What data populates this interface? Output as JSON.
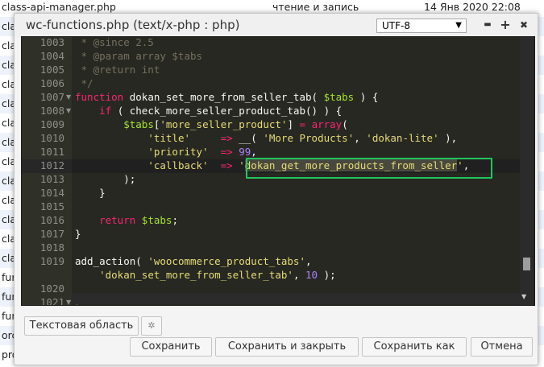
{
  "background_rows": [
    {
      "name": "class-api-manager.php",
      "perm": "чтение и запись",
      "date": "14 Янв 2020 22:08"
    },
    {
      "name": "cla"
    },
    {
      "name": "cla"
    },
    {
      "name": "cla"
    },
    {
      "name": "cla"
    },
    {
      "name": "cla"
    },
    {
      "name": "cla"
    },
    {
      "name": "cla"
    },
    {
      "name": "cla"
    },
    {
      "name": "cla"
    },
    {
      "name": "cla"
    },
    {
      "name": "cla"
    },
    {
      "name": "cla"
    },
    {
      "name": "cla"
    },
    {
      "name": "fur"
    },
    {
      "name": "fur"
    },
    {
      "name": "fur"
    },
    {
      "name": "orc"
    },
    {
      "name": "pro"
    }
  ],
  "dialog": {
    "title": "wc-functions.php (text/x-php : php)",
    "encoding": "UTF-8",
    "minimize": "▬",
    "maximize": "+",
    "close": "✖"
  },
  "editor": {
    "lines": [
      {
        "num": "1003",
        "fold": "",
        "segments": [
          {
            "t": " * @since 2.5",
            "c": "c-comment"
          }
        ]
      },
      {
        "num": "1004",
        "fold": "",
        "segments": [
          {
            "t": " * @param array $tabs",
            "c": "c-comment"
          }
        ]
      },
      {
        "num": "1005",
        "fold": "",
        "segments": [
          {
            "t": " * @return int",
            "c": "c-comment"
          }
        ]
      },
      {
        "num": "1006",
        "fold": "",
        "segments": [
          {
            "t": " */",
            "c": "c-comment"
          }
        ]
      },
      {
        "num": "1007",
        "fold": "▼",
        "segments": [
          {
            "t": "function",
            "c": "c-kw"
          },
          {
            "t": " dokan_set_more_from_seller_tab( ",
            "c": "c-plain"
          },
          {
            "t": "$tabs",
            "c": "c-var"
          },
          {
            "t": " ) {",
            "c": "c-plain"
          }
        ]
      },
      {
        "num": "1008",
        "fold": "▼",
        "segments": [
          {
            "t": "    ",
            "c": "c-plain"
          },
          {
            "t": "if",
            "c": "c-kw"
          },
          {
            "t": " ( check_more_seller_product_tab() ) {",
            "c": "c-plain"
          }
        ]
      },
      {
        "num": "1009",
        "fold": "",
        "segments": [
          {
            "t": "        ",
            "c": "c-plain"
          },
          {
            "t": "$tabs",
            "c": "c-var"
          },
          {
            "t": "[",
            "c": "c-plain"
          },
          {
            "t": "'more_seller_product'",
            "c": "c-str"
          },
          {
            "t": "] ",
            "c": "c-plain"
          },
          {
            "t": "=",
            "c": "c-kw"
          },
          {
            "t": " ",
            "c": "c-plain"
          },
          {
            "t": "array",
            "c": "c-kw"
          },
          {
            "t": "(",
            "c": "c-plain"
          }
        ]
      },
      {
        "num": "1010",
        "fold": "",
        "segments": [
          {
            "t": "            ",
            "c": "c-plain"
          },
          {
            "t": "'title'",
            "c": "c-str"
          },
          {
            "t": "     ",
            "c": "c-plain"
          },
          {
            "t": "=>",
            "c": "c-kw"
          },
          {
            "t": " __( ",
            "c": "c-plain"
          },
          {
            "t": "'More Products'",
            "c": "c-str"
          },
          {
            "t": ", ",
            "c": "c-plain"
          },
          {
            "t": "'dokan-lite'",
            "c": "c-str"
          },
          {
            "t": " ),",
            "c": "c-plain"
          }
        ]
      },
      {
        "num": "1011",
        "fold": "",
        "segments": [
          {
            "t": "            ",
            "c": "c-plain"
          },
          {
            "t": "'priority'",
            "c": "c-str"
          },
          {
            "t": "  ",
            "c": "c-plain"
          },
          {
            "t": "=>",
            "c": "c-kw"
          },
          {
            "t": " ",
            "c": "c-plain"
          },
          {
            "t": "99",
            "c": "c-num"
          },
          {
            "t": ",",
            "c": "c-plain"
          }
        ]
      },
      {
        "num": "1012",
        "fold": "",
        "active": true,
        "segments": [
          {
            "t": "            ",
            "c": "c-plain"
          },
          {
            "t": "'callback'",
            "c": "c-str"
          },
          {
            "t": "  ",
            "c": "c-plain"
          },
          {
            "t": "=>",
            "c": "c-kw"
          },
          {
            "t": " ",
            "c": "c-plain"
          },
          {
            "t": "'",
            "c": "c-str"
          },
          {
            "t": "dokan_get_more_products_from_seller",
            "c": "c-str",
            "sel": true
          },
          {
            "t": "'",
            "c": "c-str"
          },
          {
            "t": ",",
            "c": "c-plain"
          }
        ]
      },
      {
        "num": "1013",
        "fold": "",
        "segments": [
          {
            "t": "        );",
            "c": "c-plain"
          }
        ]
      },
      {
        "num": "1014",
        "fold": "",
        "segments": [
          {
            "t": "    }",
            "c": "c-plain"
          }
        ]
      },
      {
        "num": "1015",
        "fold": "",
        "segments": [
          {
            "t": "",
            "c": "c-plain"
          }
        ]
      },
      {
        "num": "1016",
        "fold": "",
        "segments": [
          {
            "t": "    ",
            "c": "c-plain"
          },
          {
            "t": "return",
            "c": "c-kw"
          },
          {
            "t": " ",
            "c": "c-plain"
          },
          {
            "t": "$tabs",
            "c": "c-var"
          },
          {
            "t": ";",
            "c": "c-plain"
          }
        ]
      },
      {
        "num": "1017",
        "fold": "",
        "segments": [
          {
            "t": "}",
            "c": "c-plain"
          }
        ]
      },
      {
        "num": "1018",
        "fold": "",
        "segments": [
          {
            "t": "",
            "c": "c-plain"
          }
        ]
      },
      {
        "num": "1019",
        "fold": "",
        "segments": [
          {
            "t": "add_action( ",
            "c": "c-plain"
          },
          {
            "t": "'woocommerce_product_tabs'",
            "c": "c-str"
          },
          {
            "t": ",",
            "c": "c-plain"
          }
        ]
      },
      {
        "num": "",
        "fold": "",
        "segments": [
          {
            "t": "    ",
            "c": "c-plain"
          },
          {
            "t": "'dokan_set_more_from_seller_tab'",
            "c": "c-str"
          },
          {
            "t": ", ",
            "c": "c-plain"
          },
          {
            "t": "10",
            "c": "c-num"
          },
          {
            "t": " );",
            "c": "c-plain"
          }
        ]
      },
      {
        "num": "1020",
        "fold": "",
        "segments": [
          {
            "t": "",
            "c": "c-plain"
          }
        ]
      },
      {
        "num": "1021",
        "fold": "▼",
        "segments": [
          {
            "t": "/**",
            "c": "c-comment"
          }
        ]
      }
    ]
  },
  "footer": {
    "textarea_label": "Текстовая область",
    "gear": "✲",
    "save": "Сохранить",
    "save_close": "Сохранить и закрыть",
    "save_as": "Сохранить как",
    "cancel": "Отмена"
  }
}
